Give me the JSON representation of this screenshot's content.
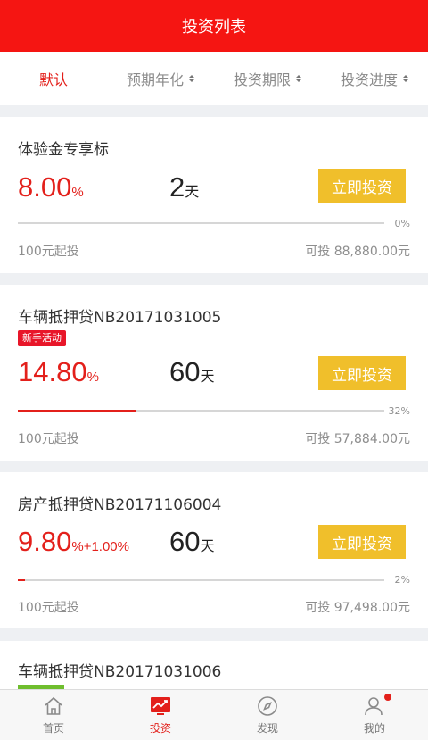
{
  "header": {
    "title": "投资列表"
  },
  "filters": [
    {
      "label": "默认",
      "active": true
    },
    {
      "label": "预期年化",
      "sortable": true
    },
    {
      "label": "投资期限",
      "sortable": true
    },
    {
      "label": "投资进度",
      "sortable": true
    }
  ],
  "products": [
    {
      "title": "体验金专享标",
      "rate": "8.00",
      "rate_unit": "%",
      "bonus": "",
      "days": "2",
      "days_unit": "天",
      "button": "立即投资",
      "progress_percent": 0,
      "progress_label": "0%",
      "min_invest": "100元起投",
      "available": "可投 88,880.00元"
    },
    {
      "title": "车辆抵押贷NB20171031005",
      "badge": "新手活动",
      "rate": "14.80",
      "rate_unit": "%",
      "bonus": "",
      "days": "60",
      "days_unit": "天",
      "button": "立即投资",
      "progress_percent": 32,
      "progress_label": "32%",
      "min_invest": "100元起投",
      "available": "可投 57,884.00元"
    },
    {
      "title": "房产抵押贷NB20171106004",
      "rate": "9.80",
      "rate_unit": "%",
      "bonus": "+1.00%",
      "days": "60",
      "days_unit": "天",
      "button": "立即投资",
      "progress_percent": 2,
      "progress_label": "2%",
      "min_invest": "100元起投",
      "available": "可投 97,498.00元"
    },
    {
      "title": "车辆抵押贷NB20171031006"
    }
  ],
  "tabbar": [
    {
      "label": "首页",
      "icon": "home-icon"
    },
    {
      "label": "投资",
      "icon": "invest-chart-icon",
      "active": true
    },
    {
      "label": "发现",
      "icon": "compass-icon"
    },
    {
      "label": "我的",
      "icon": "user-icon",
      "notification_dot": true
    }
  ],
  "colors": {
    "brand_red": "#f51512",
    "accent_red": "#e3201b",
    "button_yellow": "#f0bf2b",
    "badge_red": "#e81629",
    "badge_green": "#6fbe2e"
  }
}
